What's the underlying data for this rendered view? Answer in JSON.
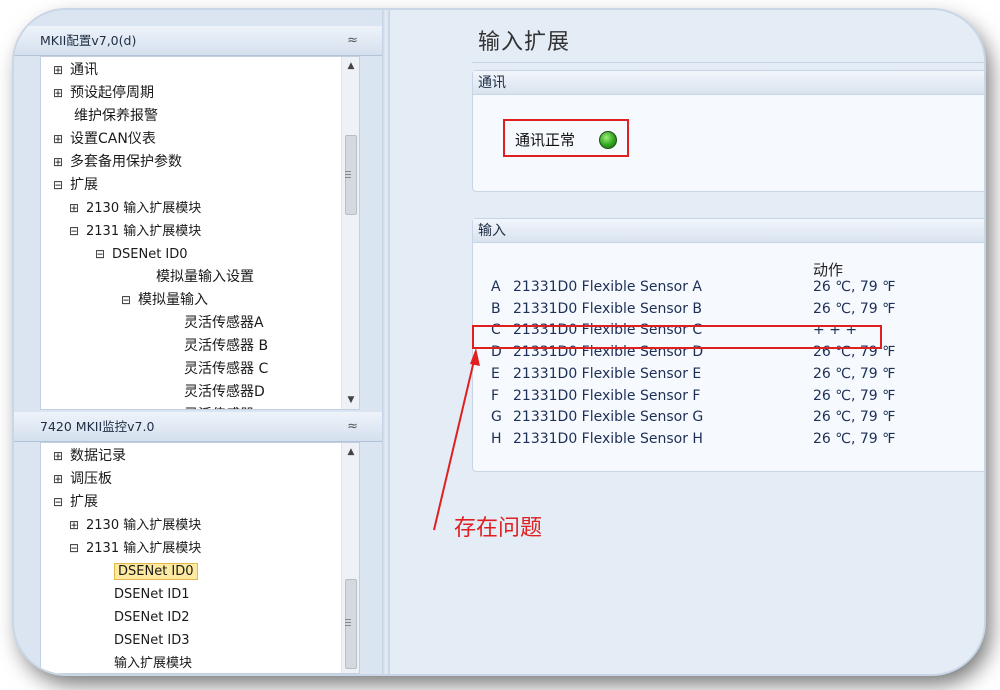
{
  "left": {
    "config_pane": {
      "title": "MKII配置v7,0(d)",
      "collapse_glyph": "≈",
      "items": [
        {
          "box": "⊞",
          "label": "通讯"
        },
        {
          "box": "⊞",
          "label": "预设起停周期"
        },
        {
          "box": "",
          "label": "维护保养报警"
        },
        {
          "box": "⊞",
          "label": "设置CAN仪表"
        },
        {
          "box": "⊞",
          "label": "多套备用保护参数"
        },
        {
          "box": "⊟",
          "label": "扩展"
        },
        {
          "box": "⊞",
          "label": "2130 输入扩展模块"
        },
        {
          "box": "⊟",
          "label": "2131 输入扩展模块"
        },
        {
          "box": "⊟",
          "label": "DSENet ID0"
        },
        {
          "box": "",
          "label": "模拟量输入设置"
        },
        {
          "box": "⊟",
          "label": "模拟量输入"
        },
        {
          "box": "",
          "label": "灵活传感器A"
        },
        {
          "box": "",
          "label": "灵活传感器 B"
        },
        {
          "box": "",
          "label": "灵活传感器 C"
        },
        {
          "box": "",
          "label": "灵活传感器D"
        },
        {
          "box": "",
          "label": "灵活传感器"
        }
      ]
    },
    "monitor_pane": {
      "title": "7420 MKII监控v7.0",
      "collapse_glyph": "≈",
      "items": [
        {
          "box": "⊞",
          "label": "数据记录"
        },
        {
          "box": "⊞",
          "label": "调压板"
        },
        {
          "box": "⊟",
          "label": "扩展"
        },
        {
          "box": "⊞",
          "label": "2130 输入扩展模块"
        },
        {
          "box": "⊟",
          "label": "2131 输入扩展模块"
        },
        {
          "box": "",
          "label": "DSENet ID0"
        },
        {
          "box": "",
          "label": "DSENet ID1"
        },
        {
          "box": "",
          "label": "DSENet ID2"
        },
        {
          "box": "",
          "label": "DSENet ID3"
        },
        {
          "box": "",
          "label": "输入扩展模块"
        }
      ],
      "selected_index": 5
    },
    "scroll_up": "▲",
    "scroll_down": "▼"
  },
  "main": {
    "page_title": "输入扩展",
    "comm_group": {
      "title": "通讯",
      "status": "通讯正常"
    },
    "input_group": {
      "title": "输入",
      "action_header": "动作",
      "rows": [
        {
          "letter": "A",
          "name": "21331D0 Flexible Sensor A",
          "value": "26 ℃,  79 ℉"
        },
        {
          "letter": "B",
          "name": "21331D0 Flexible Sensor B",
          "value": "26 ℃,  79 ℉"
        },
        {
          "letter": "C",
          "name": "21331D0 Flexible Sensor C",
          "value": "+ + +"
        },
        {
          "letter": "D",
          "name": "21331D0 Flexible Sensor D",
          "value": "26 ℃,  79 ℉"
        },
        {
          "letter": "E",
          "name": "21331D0 Flexible Sensor E",
          "value": "26 ℃,  79 ℉"
        },
        {
          "letter": "F",
          "name": "21331D0 Flexible Sensor F",
          "value": "26 ℃,  79 ℉"
        },
        {
          "letter": "G",
          "name": "21331D0 Flexible Sensor G",
          "value": "26 ℃,  79 ℉"
        },
        {
          "letter": "H",
          "name": "21331D0 Flexible Sensor H",
          "value": "26 ℃,  79 ℉"
        }
      ]
    },
    "annotation": "存在问题"
  },
  "colors": {
    "annotation_red": "#e02020",
    "led_green": "#2fa31c",
    "selection": "#fdeaa0"
  }
}
